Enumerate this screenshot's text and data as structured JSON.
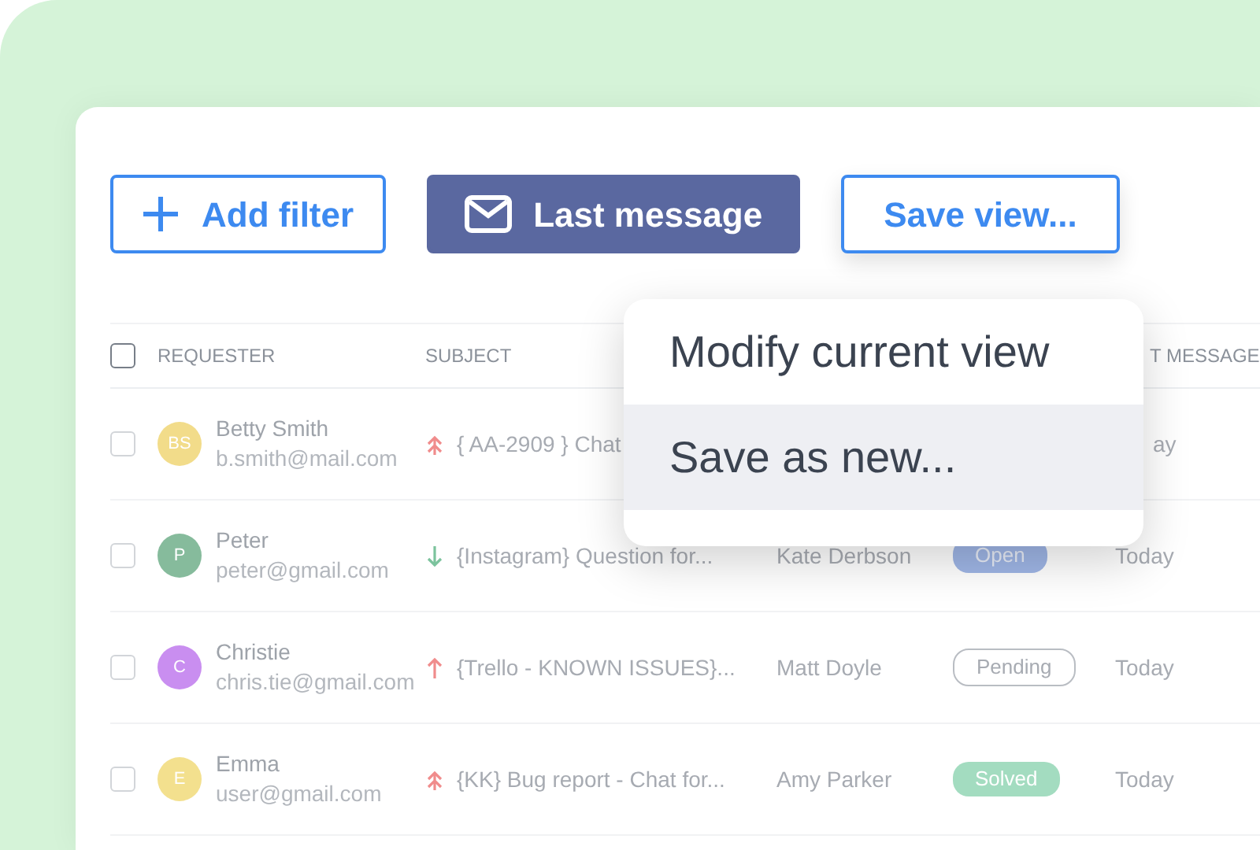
{
  "toolbar": [
    {
      "kind": "add",
      "label": "Add filter"
    },
    {
      "kind": "mail",
      "label": "Last message"
    },
    {
      "kind": "plain",
      "label": "Save view..."
    }
  ],
  "table": {
    "select_all": {
      "checked": false
    },
    "columns": {
      "requester": "REQUESTER",
      "subject": "SUBJECT",
      "column_6": "T MESSAGE"
    },
    "rows": [
      {
        "checked": false,
        "initials": "BS",
        "color": "#f2dc8a",
        "name": "Betty Smith",
        "email": "b.smith@mail.com",
        "kind": "urgent",
        "subject": "{ AA-2909 } Chat",
        "last": "ay"
      },
      {
        "checked": false,
        "initials": "P",
        "color": "#86bb9c",
        "name": "Peter",
        "email": "peter@gmail.com",
        "kind": "low",
        "subject": "{Instagram} Question for...",
        "agent": "Kate Derbson",
        "status": {
          "kind": "open",
          "label": "Open"
        },
        "last": "Today"
      },
      {
        "checked": false,
        "initials": "C",
        "color": "#c98ef0",
        "name": "Christie",
        "email": "chris.tie@gmail.com",
        "kind": "high",
        "subject": "{Trello - KNOWN ISSUES}...",
        "agent": "Matt Doyle",
        "status": {
          "kind": "pending",
          "label": "Pending"
        },
        "last": "Today"
      },
      {
        "checked": false,
        "initials": "E",
        "color": "#f3e08e",
        "name": "Emma",
        "email": "user@gmail.com",
        "kind": "urgent",
        "subject": "{KK} Bug report - Chat for...",
        "agent": "Amy Parker",
        "status": {
          "kind": "solved",
          "label": "Solved"
        },
        "last": "Today"
      }
    ]
  },
  "menu": [
    {
      "label": "Modify current view",
      "selected": false
    },
    {
      "label": "Save as new...",
      "selected": true
    }
  ]
}
